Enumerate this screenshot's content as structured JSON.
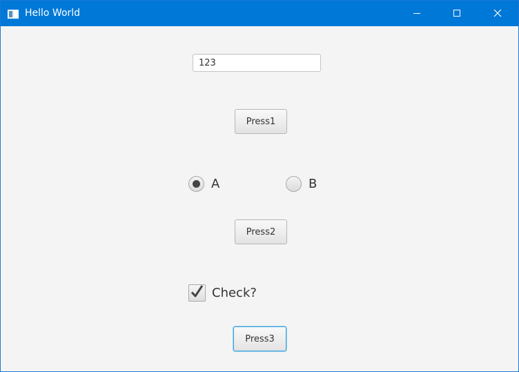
{
  "window": {
    "title": "Hello World"
  },
  "form": {
    "text_field_value": "123",
    "press1_label": "Press1",
    "radio_a_label": "A",
    "radio_a_selected": true,
    "radio_b_label": "B",
    "radio_b_selected": false,
    "press2_label": "Press2",
    "checkbox_label": "Check?",
    "checkbox_checked": true,
    "press3_label": "Press3"
  },
  "colors": {
    "titlebar": "#0078d7",
    "focus_ring": "#3fa3dc"
  },
  "icons": {
    "app": "app-window-icon",
    "minimize": "minimize-icon",
    "maximize": "maximize-icon",
    "close": "close-icon",
    "check": "checkmark-icon"
  }
}
